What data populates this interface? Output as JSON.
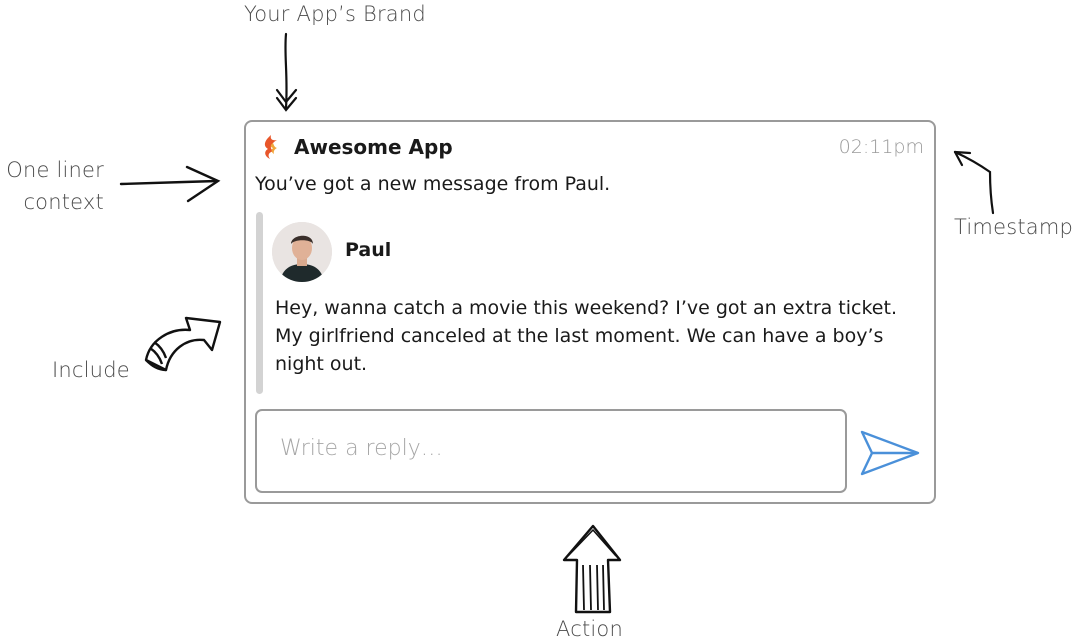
{
  "annotations": {
    "brand": "Your App’s Brand",
    "context_line1": "One liner",
    "context_line2": "context",
    "timestamp": "Timestamp",
    "include": "Include",
    "action": "Action"
  },
  "notification": {
    "app_name": "Awesome App",
    "timestamp": "02:11pm",
    "context": "You’ve got a new message from Paul.",
    "sender": "Paul",
    "message": "Hey, wanna catch a movie this weekend? I’ve got an extra ticket. My girlfriend canceled at the last moment. We can have a boy’s night out.",
    "reply_placeholder": "Write a reply…"
  },
  "icons": {
    "logo": "flame-logo-icon",
    "send": "send-paper-plane-icon",
    "avatar": "user-avatar"
  },
  "colors": {
    "border": "#9a9a9a",
    "send_icon": "#4a90d9",
    "logo_primary": "#e8562a",
    "logo_secondary": "#f0a63a"
  }
}
